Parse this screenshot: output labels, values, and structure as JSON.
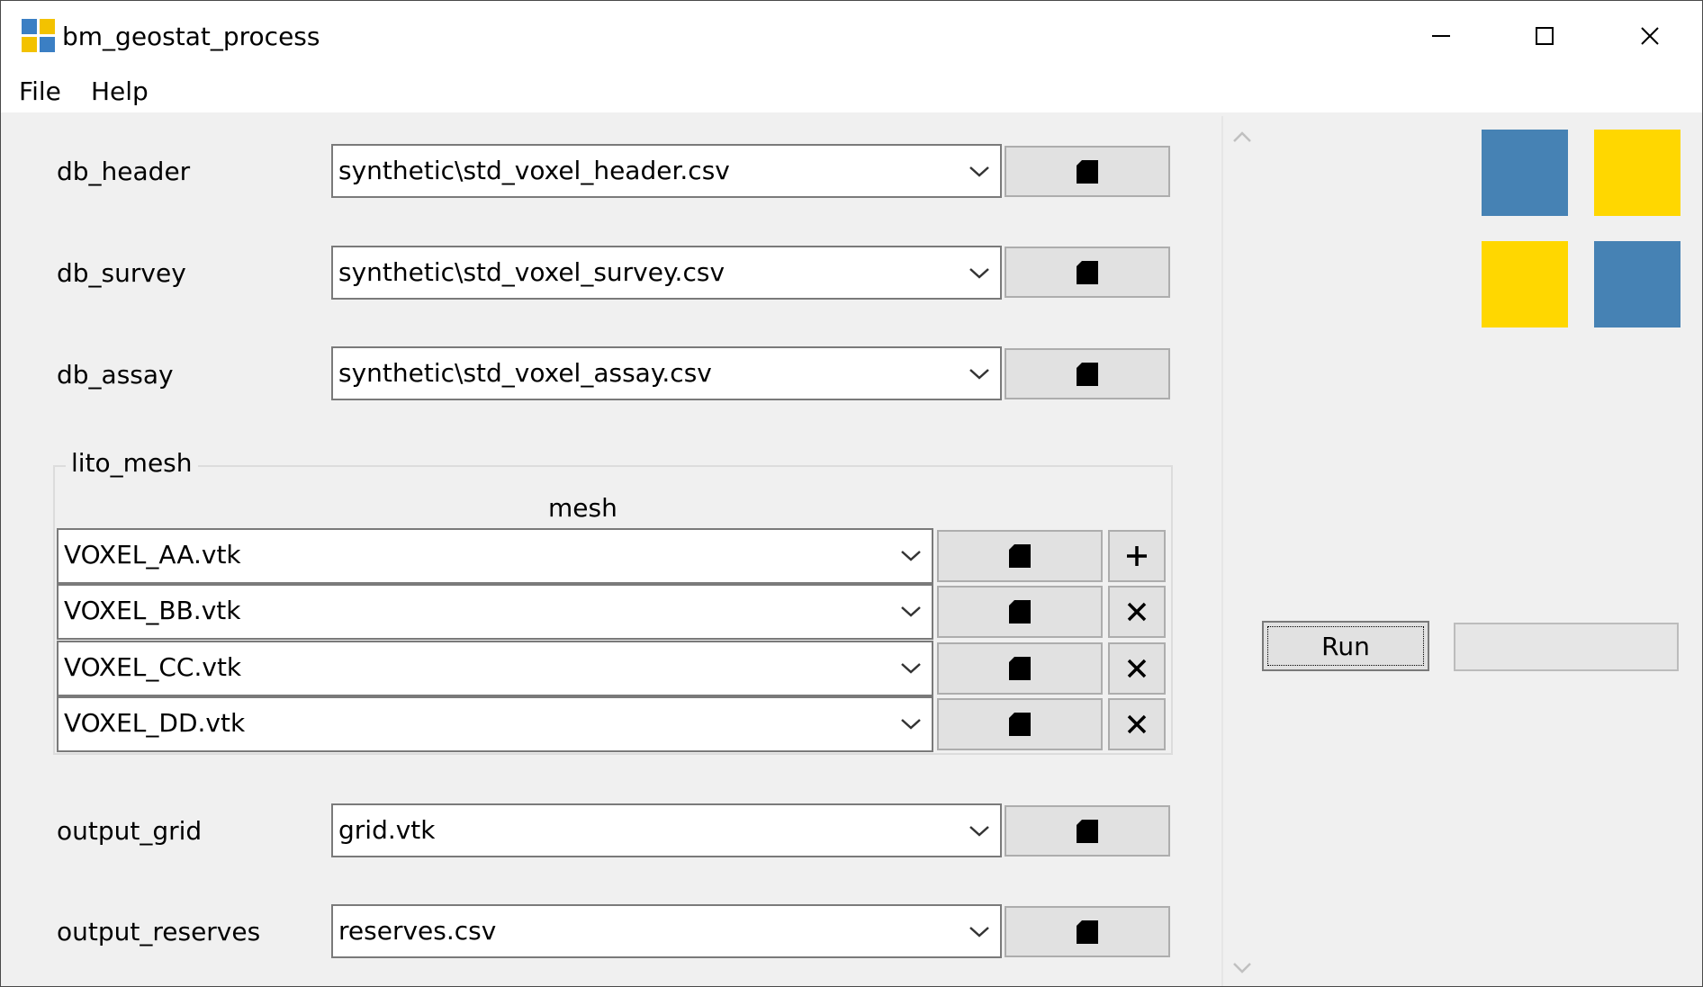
{
  "window": {
    "title": "bm_geostat_process",
    "icon_colors": [
      "#3b7fc4",
      "#f3c200",
      "#f3c200",
      "#3b7fc4"
    ]
  },
  "menu": {
    "file": "File",
    "help": "Help"
  },
  "fields": {
    "db_header": {
      "label": "db_header",
      "value": "synthetic\\std_voxel_header.csv"
    },
    "db_survey": {
      "label": "db_survey",
      "value": "synthetic\\std_voxel_survey.csv"
    },
    "db_assay": {
      "label": "db_assay",
      "value": "synthetic\\std_voxel_assay.csv"
    },
    "output_grid": {
      "label": "output_grid",
      "value": "grid.vtk"
    },
    "output_reserves": {
      "label": "output_reserves",
      "value": "reserves.csv"
    }
  },
  "lito_mesh": {
    "title": "lito_mesh",
    "column_header": "mesh",
    "rows": [
      {
        "value": "VOXEL_AA.vtk",
        "action": "add"
      },
      {
        "value": "VOXEL_BB.vtk",
        "action": "remove"
      },
      {
        "value": "VOXEL_CC.vtk",
        "action": "remove"
      },
      {
        "value": "VOXEL_DD.vtk",
        "action": "remove"
      }
    ]
  },
  "right_panel": {
    "run_label": "Run",
    "progress": 0,
    "logo_colors": [
      "#4682b4",
      "#ffd700",
      "#ffd700",
      "#4682b4"
    ]
  }
}
